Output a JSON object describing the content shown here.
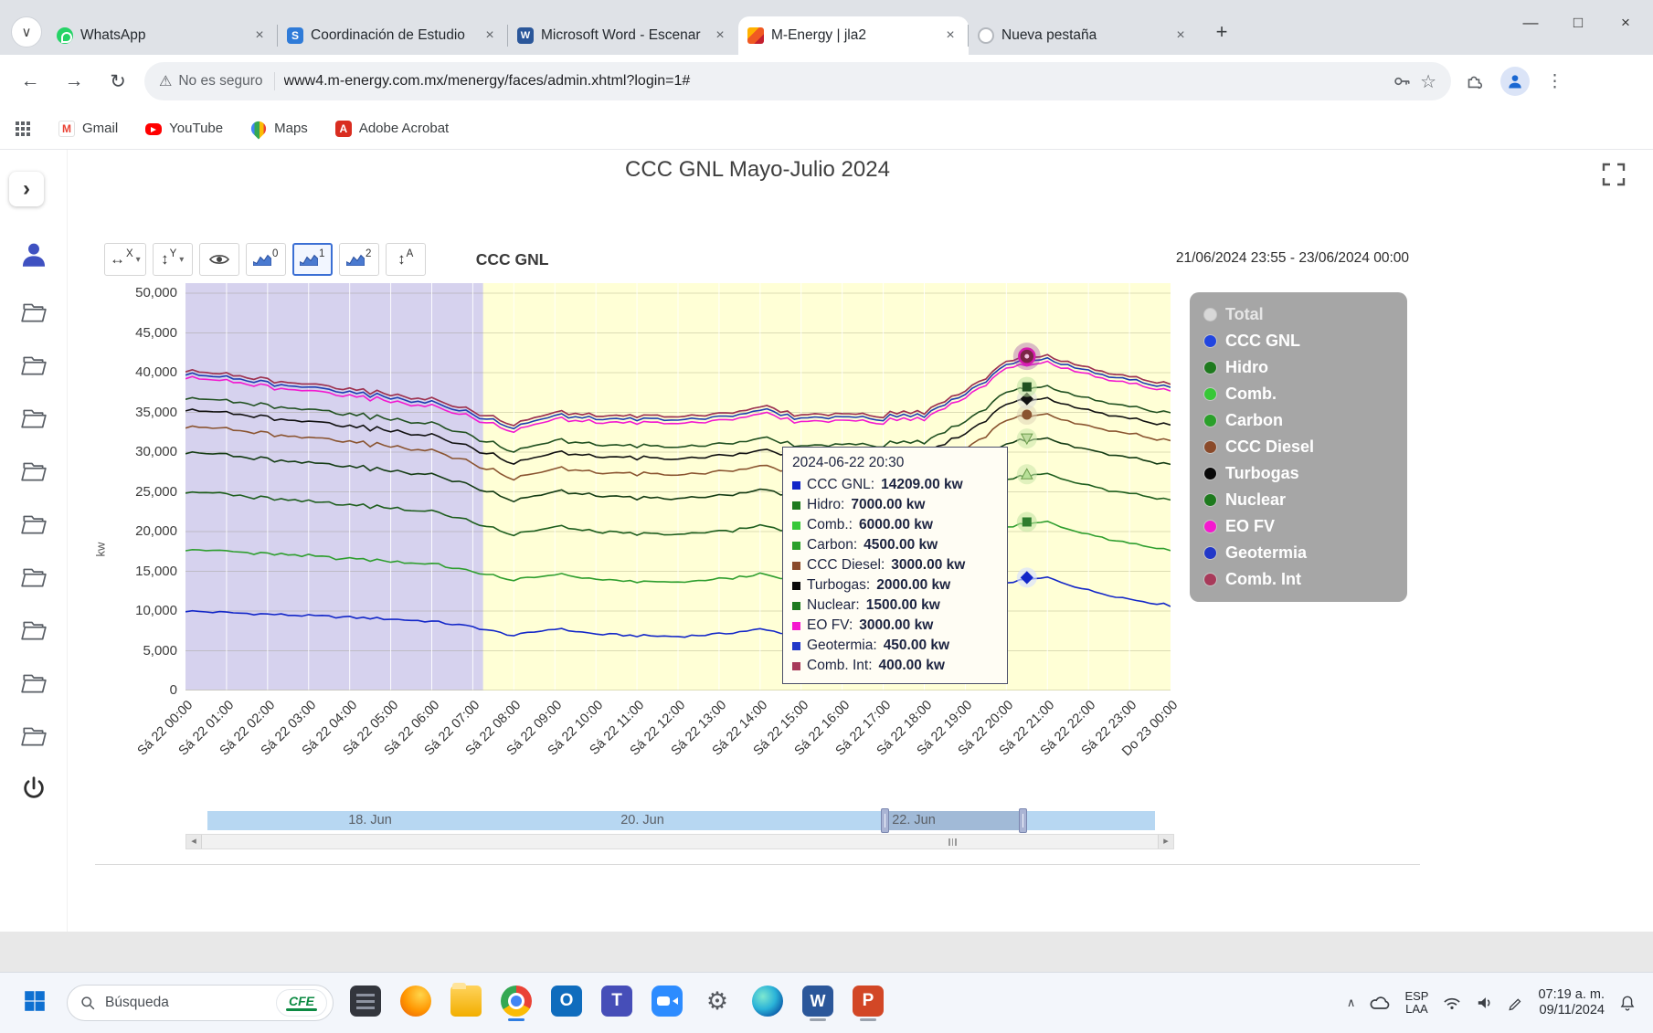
{
  "icons": {
    "close": "×",
    "minimize": "—",
    "maximize": "□",
    "plus": "+",
    "tab_search": "∨",
    "tray_chevron": "∧",
    "back": "←",
    "forward": "→",
    "reload": "↻",
    "warning": "⚠",
    "star": "☆",
    "kebab": "⋮",
    "caret_down": "▾",
    "h_arrows": "↔",
    "v_arrows": "↕",
    "chevron_expand": "›",
    "scroll_left": "◂",
    "scroll_right": "▸"
  },
  "browser": {
    "tabs": [
      {
        "label": "WhatsApp",
        "icon": "whatsapp",
        "active": false
      },
      {
        "label": "Coordinación de Estudio",
        "icon": "scholar",
        "active": false
      },
      {
        "label": "Microsoft Word - Escenar",
        "icon": "word",
        "active": false
      },
      {
        "label": "M-Energy | jla2",
        "icon": "menergy",
        "active": true
      },
      {
        "label": "Nueva pestaña",
        "icon": "blank",
        "active": false
      }
    ],
    "address": {
      "security_chip": "No es seguro",
      "url": "www4.m-energy.com.mx/menergy/faces/admin.xhtml?login=1#"
    },
    "bookmarks": [
      {
        "label": "Gmail",
        "icon": "gmail"
      },
      {
        "label": "YouTube",
        "icon": "youtube"
      },
      {
        "label": "Maps",
        "icon": "maps"
      },
      {
        "label": "Adobe Acrobat",
        "icon": "acrobat"
      }
    ]
  },
  "app": {
    "title": "CCC GNL Mayo-Julio 2024",
    "toolbar": {
      "x_button": "X",
      "y_button": "Y",
      "a_button": "A",
      "chart_buttons": [
        "0",
        "1",
        "2"
      ],
      "series_name": "CCC GNL",
      "date_range": "21/06/2024 23:55  -  23/06/2024 00:00"
    },
    "tooltip": {
      "title": "2024-06-22 20:30",
      "entries": [
        {
          "name": "CCC GNL",
          "label": "14209.00 kw",
          "color": "#1327c8"
        },
        {
          "name": "Hidro",
          "label": "7000.00 kw",
          "color": "#1e7a1e"
        },
        {
          "name": "Comb.",
          "label": "6000.00 kw",
          "color": "#37c837"
        },
        {
          "name": "Carbon",
          "label": "4500.00 kw",
          "color": "#2aa02a"
        },
        {
          "name": "CCC Diesel",
          "label": "3000.00 kw",
          "color": "#8a4a2a"
        },
        {
          "name": "Turbogas",
          "label": "2000.00 kw",
          "color": "#0a0a0a"
        },
        {
          "name": "Nuclear",
          "label": "1500.00 kw",
          "color": "#1e7a1e"
        },
        {
          "name": "EO FV",
          "label": "3000.00 kw",
          "color": "#f519cf"
        },
        {
          "name": "Geotermia",
          "label": "450.00 kw",
          "color": "#2238c8"
        },
        {
          "name": "Comb. Int",
          "label": "400.00 kw",
          "color": "#a83a5a"
        }
      ]
    },
    "legend": {
      "items": [
        {
          "label": "Total",
          "color": "#d8d8d8",
          "muted": true
        },
        {
          "label": "CCC GNL",
          "color": "#2246e0",
          "muted": false
        },
        {
          "label": "Hidro",
          "color": "#1e7a1e",
          "muted": false
        },
        {
          "label": "Comb.",
          "color": "#37c837",
          "muted": false
        },
        {
          "label": "Carbon",
          "color": "#2aa02a",
          "muted": false
        },
        {
          "label": "CCC Diesel",
          "color": "#8a4a2a",
          "muted": false
        },
        {
          "label": "Turbogas",
          "color": "#0a0a0a",
          "muted": false
        },
        {
          "label": "Nuclear",
          "color": "#1e7a1e",
          "muted": false
        },
        {
          "label": "EO FV",
          "color": "#f519cf",
          "muted": false
        },
        {
          "label": "Geotermia",
          "color": "#2238c8",
          "muted": false
        },
        {
          "label": "Comb. Int",
          "color": "#a83a5a",
          "muted": false
        }
      ]
    },
    "navigator": {
      "labels": [
        "18. Jun",
        "20. Jun",
        "22. Jun"
      ]
    }
  },
  "chart_data": {
    "type": "line",
    "stacked": true,
    "title": "CCC GNL Mayo-Julio 2024",
    "ylabel": "kw",
    "ylim": [
      0,
      50000
    ],
    "ytick_step": 5000,
    "y_tick_labels": [
      "0",
      "5,000",
      "10,000",
      "15,000",
      "20,000",
      "25,000",
      "30,000",
      "35,000",
      "40,000",
      "45,000",
      "50,000"
    ],
    "x_tick_labels": [
      "Sá 22 00:00",
      "Sá 22 01:00",
      "Sá 22 02:00",
      "Sá 22 03:00",
      "Sá 22 04:00",
      "Sá 22 05:00",
      "Sá 22 06:00",
      "Sá 22 07:00",
      "Sá 22 08:00",
      "Sá 22 09:00",
      "Sá 22 10:00",
      "Sá 22 11:00",
      "Sá 22 12:00",
      "Sá 22 13:00",
      "Sá 22 14:00",
      "Sá 22 15:00",
      "Sá 22 16:00",
      "Sá 22 17:00",
      "Sá 22 18:00",
      "Sá 22 19:00",
      "Sá 22 20:00",
      "Sá 22 21:00",
      "Sá 22 22:00",
      "Sá 22 23:00",
      "Do 23 00:00"
    ],
    "plot_bg": "#ffffd6",
    "shaded_bg": "#d6d2ee",
    "shaded_region_end_hour": 7.25,
    "total": {
      "name": "Total",
      "color": "#9e9e9e"
    },
    "series": [
      {
        "name": "CCC GNL",
        "color": "#1327c8",
        "values": [
          10000,
          9800,
          9600,
          9400,
          9200,
          9000,
          8700,
          8000,
          6900,
          7800,
          7100,
          6900,
          6800,
          7100,
          7700,
          6900,
          7100,
          7000,
          7300,
          9800,
          13600,
          14200,
          12600,
          11500,
          10700
        ]
      },
      {
        "name": "Hidro",
        "color": "#2e9e2e",
        "values": [
          7800,
          7700,
          7600,
          7500,
          7400,
          7300,
          7200,
          7000,
          6900,
          6900,
          6800,
          6800,
          6800,
          6900,
          6900,
          6800,
          6900,
          6900,
          7000,
          7000,
          7000,
          7000,
          7100,
          7100,
          7000
        ]
      },
      {
        "name": "Comb.",
        "color": "#1e5e1e",
        "values": [
          7300,
          7150,
          7000,
          6900,
          6800,
          6700,
          6600,
          6300,
          5700,
          6000,
          6000,
          6000,
          6000,
          6000,
          6100,
          6000,
          6000,
          6000,
          6000,
          6000,
          6000,
          6000,
          6100,
          6200,
          6300
        ]
      },
      {
        "name": "Carbon",
        "color": "#143c14",
        "values": [
          5000,
          4950,
          4900,
          4850,
          4800,
          4700,
          4600,
          4500,
          4300,
          4450,
          4500,
          4500,
          4500,
          4500,
          4550,
          4500,
          4500,
          4500,
          4500,
          4500,
          4500,
          4500,
          4500,
          4500,
          4500
        ]
      },
      {
        "name": "CCC Diesel",
        "color": "#8a5430",
        "values": [
          3300,
          3250,
          3200,
          3150,
          3100,
          3050,
          3000,
          2900,
          2750,
          2900,
          2950,
          3000,
          3000,
          3000,
          3000,
          3000,
          3000,
          3000,
          3000,
          3000,
          3000,
          3000,
          3000,
          3000,
          3000
        ]
      },
      {
        "name": "Turbogas",
        "color": "#101010",
        "values": [
          2100,
          2050,
          2000,
          2000,
          1950,
          1950,
          1900,
          1900,
          1950,
          2000,
          2000,
          2000,
          2000,
          2000,
          2000,
          2000,
          2000,
          2000,
          2000,
          2000,
          2000,
          2000,
          2000,
          1950,
          1950
        ]
      },
      {
        "name": "Nuclear",
        "color": "#205020",
        "values": [
          1500,
          1500,
          1500,
          1500,
          1500,
          1500,
          1500,
          1500,
          1500,
          1500,
          1500,
          1500,
          1500,
          1500,
          1500,
          1500,
          1500,
          1500,
          1500,
          1500,
          1500,
          1500,
          1500,
          1500,
          1500
        ]
      },
      {
        "name": "EO FV",
        "color": "#f219d0",
        "values": [
          2600,
          2500,
          2400,
          2300,
          2300,
          2200,
          2200,
          2300,
          2500,
          2700,
          2800,
          2900,
          3000,
          3000,
          3100,
          3000,
          3000,
          2900,
          2900,
          3000,
          3000,
          3000,
          3000,
          2900,
          2800
        ]
      },
      {
        "name": "Geotermia",
        "color": "#1e3db0",
        "values": [
          450,
          450,
          450,
          450,
          450,
          450,
          450,
          450,
          450,
          450,
          450,
          450,
          450,
          450,
          450,
          450,
          450,
          450,
          450,
          450,
          450,
          450,
          450,
          450,
          450
        ]
      },
      {
        "name": "Comb. Int",
        "color": "#a03050",
        "values": [
          400,
          400,
          400,
          400,
          400,
          400,
          400,
          400,
          400,
          400,
          400,
          400,
          400,
          400,
          400,
          400,
          400,
          400,
          400,
          400,
          400,
          400,
          400,
          400,
          400
        ]
      }
    ],
    "hover_hour": 20.5,
    "hover_values": [
      14209,
      7000,
      6000,
      4500,
      3000,
      2000,
      1500,
      3000,
      450,
      400
    ],
    "hover_markers": [
      {
        "shape": "diamond",
        "color": "#1327c8",
        "halo": "rgba(215,225,255,0.65)"
      },
      {
        "shape": "square",
        "color": "#2e7d2e",
        "halo": "rgba(190,225,160,0.55)"
      },
      {
        "shape": "triangle-up",
        "color": "#b8e098",
        "halo": "rgba(200,230,170,0.55)"
      },
      {
        "shape": "triangle-down",
        "color": "#c0dca0",
        "halo": "rgba(200,230,170,0.55)"
      },
      {
        "shape": "circle",
        "color": "#8a5430",
        "halo": "rgba(220,210,180,0.5)"
      },
      {
        "shape": "diamond",
        "color": "#101010",
        "halo": "rgba(220,220,220,0.5)"
      },
      {
        "shape": "square",
        "color": "#205020",
        "halo": "rgba(190,225,160,0.55)"
      },
      null,
      null,
      {
        "shape": "big-circle",
        "color": "#7a2546",
        "ring": "#d81bb0",
        "halo": "rgba(150,60,160,0.35)"
      }
    ]
  },
  "sidebar": {
    "folder_count": 9
  },
  "taskbar": {
    "search": {
      "placeholder": "Búsqueda",
      "badge": "CFE"
    },
    "apps": [
      {
        "name": "dark",
        "active": false
      },
      {
        "name": "firefox",
        "active": false
      },
      {
        "name": "explorer",
        "active": false
      },
      {
        "name": "chrome",
        "active": true
      },
      {
        "name": "outlook",
        "active": false
      },
      {
        "name": "teams",
        "active": false
      },
      {
        "name": "zoom",
        "active": false
      },
      {
        "name": "settings",
        "active": false
      },
      {
        "name": "edge",
        "active": false
      },
      {
        "name": "word",
        "active": true
      },
      {
        "name": "powerpoint",
        "active": true
      }
    ],
    "tray": {
      "language_top": "ESP",
      "language_bottom": "LAA",
      "time": "07:19 a. m.",
      "date": "09/11/2024"
    }
  }
}
